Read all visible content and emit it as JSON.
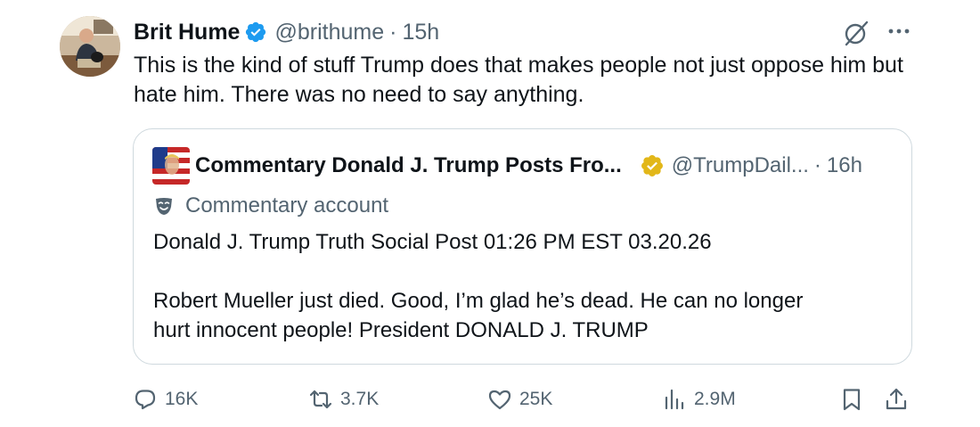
{
  "tweet": {
    "author_name": "Brit Hume",
    "handle": "@brithume",
    "separator": "·",
    "time": "15h",
    "text": "This is the kind of stuff Trump does that makes people not just oppose him but hate him. There was no need to say anything."
  },
  "quoted": {
    "author_name": "Commentary Donald J. Trump Posts Fro...",
    "handle": "@TrumpDail...",
    "separator": "·",
    "time": "16h",
    "label": "Commentary account",
    "lines": [
      "Donald J. Trump Truth Social Post 01:26 PM EST 03.20.26",
      "Robert Mueller just died. Good, I’m glad he’s dead. He can no longer",
      "hurt innocent people! President DONALD J. TRUMP"
    ]
  },
  "actions": {
    "replies": "16K",
    "reposts": "3.7K",
    "likes": "25K",
    "views": "2.9M"
  },
  "colors": {
    "verified_blue": "#1d9bf0",
    "verified_gold": "#e2b719",
    "text_primary": "#0f1419",
    "text_secondary": "#536471",
    "border": "#cfd9de"
  },
  "icons": {
    "author_verified": "verified-blue-badge-icon",
    "quoted_verified": "verified-gold-badge-icon",
    "grok": "grok-icon",
    "more": "more-icon",
    "label": "mask-icon",
    "reply": "reply-icon",
    "repost": "repost-icon",
    "like": "like-icon",
    "views": "views-icon",
    "bookmark": "bookmark-icon",
    "share": "share-icon"
  }
}
